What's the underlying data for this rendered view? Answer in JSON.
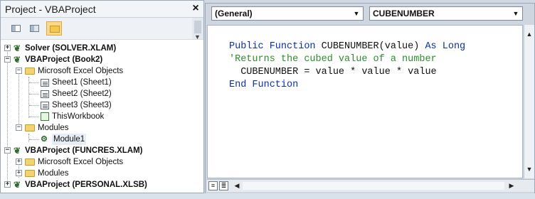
{
  "project_pane": {
    "title": "Project - VBAProject",
    "close_label": "×",
    "toolbar": [
      {
        "icon": "view-code-icon"
      },
      {
        "icon": "view-object-icon"
      },
      {
        "icon": "toggle-folders-icon"
      }
    ],
    "tree": [
      {
        "label": "Solver (SOLVER.XLAM)",
        "bold": true,
        "expander": "+",
        "icon": "vba-project-icon"
      },
      {
        "label": "VBAProject (Book2)",
        "bold": true,
        "expander": "−",
        "icon": "vba-project-icon"
      },
      {
        "label": "Microsoft Excel Objects",
        "bold": false,
        "expander": "−",
        "icon": "folder-open-icon"
      },
      {
        "label": "Sheet1 (Sheet1)",
        "bold": false,
        "icon": "worksheet-icon"
      },
      {
        "label": "Sheet2 (Sheet2)",
        "bold": false,
        "icon": "worksheet-icon"
      },
      {
        "label": "Sheet3 (Sheet3)",
        "bold": false,
        "icon": "worksheet-icon"
      },
      {
        "label": "ThisWorkbook",
        "bold": false,
        "icon": "workbook-icon"
      },
      {
        "label": "Modules",
        "bold": false,
        "expander": "−",
        "icon": "folder-open-icon"
      },
      {
        "label": "Module1",
        "bold": false,
        "icon": "module-icon"
      },
      {
        "label": "VBAProject (FUNCRES.XLAM)",
        "bold": true,
        "expander": "−",
        "icon": "vba-project-icon"
      },
      {
        "label": "Microsoft Excel Objects",
        "bold": false,
        "expander": "+",
        "icon": "folder-icon"
      },
      {
        "label": "Modules",
        "bold": false,
        "expander": "+",
        "icon": "folder-icon"
      },
      {
        "label": "VBAProject (PERSONAL.XLSB)",
        "bold": true,
        "expander": "+",
        "icon": "vba-project-icon"
      }
    ]
  },
  "code_window": {
    "object_combo": "(General)",
    "procedure_combo": "CUBENUMBER",
    "code": {
      "line1": {
        "kw1": "Public Function ",
        "tx": "CUBENUMBER(value) ",
        "kw2": "As Long"
      },
      "line2": "'Returns the cubed value of a number",
      "line3": "  CUBENUMBER = value * value * value",
      "line4": "End Function"
    }
  }
}
